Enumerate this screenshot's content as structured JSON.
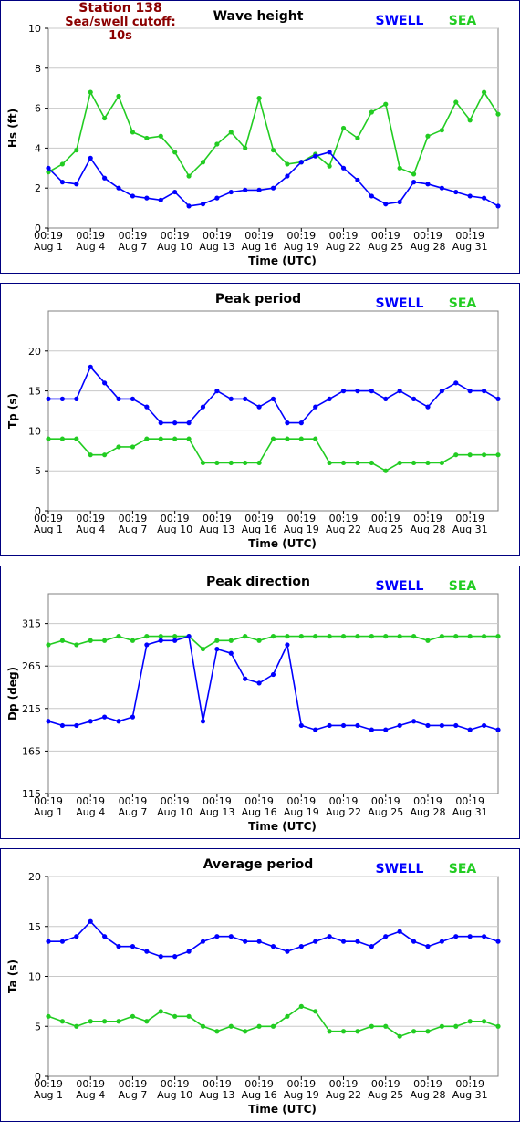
{
  "station": {
    "name": "Station 138",
    "cutoff": "Sea/swell cutoff: 10s"
  },
  "colors": {
    "swell": "#0000ff",
    "sea": "#22cc22",
    "border": "#000080",
    "grid": "#c8c8c8"
  },
  "legend": {
    "swell": "SWELL",
    "sea": "SEA"
  },
  "shared_x": {
    "xlabel": "Time (UTC)",
    "tick_time": [
      "00:19",
      "00:19",
      "00:19",
      "00:19",
      "00:19",
      "00:19",
      "00:19",
      "00:19",
      "00:19",
      "00:19",
      "00:19"
    ],
    "tick_date": [
      "Aug 1",
      "Aug 4",
      "Aug 7",
      "Aug 10",
      "Aug 13",
      "Aug 16",
      "Aug 19",
      "Aug 22",
      "Aug 25",
      "Aug 28",
      "Aug 31"
    ]
  },
  "chart_data": [
    {
      "type": "line",
      "title": "Wave height",
      "ylabel": "Hs (ft)",
      "ylim": [
        0,
        10
      ],
      "yticks": [
        0,
        2,
        4,
        6,
        8,
        10
      ],
      "x": [
        1,
        2,
        3,
        4,
        5,
        6,
        7,
        8,
        9,
        10,
        11,
        12,
        13,
        14,
        15,
        16,
        17,
        18,
        19,
        20,
        21,
        22,
        23,
        24,
        25,
        26,
        27,
        28,
        29,
        30,
        31,
        32,
        33
      ],
      "series": [
        {
          "name": "SWELL",
          "values": [
            3.0,
            2.3,
            2.2,
            3.5,
            2.5,
            2.0,
            1.6,
            1.5,
            1.4,
            1.8,
            1.1,
            1.2,
            1.5,
            1.8,
            1.9,
            1.9,
            2.0,
            2.6,
            3.3,
            3.6,
            3.8,
            3.0,
            2.4,
            1.6,
            1.2,
            1.3,
            2.3,
            2.2,
            2.0,
            1.8,
            1.6,
            1.5,
            1.1
          ]
        },
        {
          "name": "SEA",
          "values": [
            2.8,
            3.2,
            3.9,
            6.8,
            5.5,
            6.6,
            4.8,
            4.5,
            4.6,
            3.8,
            2.6,
            3.3,
            4.2,
            4.8,
            4.0,
            6.5,
            3.9,
            3.2,
            3.3,
            3.7,
            3.1,
            5.0,
            4.5,
            5.8,
            6.2,
            3.0,
            2.7,
            4.6,
            4.9,
            6.3,
            5.4,
            6.8,
            5.7
          ]
        }
      ]
    },
    {
      "type": "line",
      "title": "Peak period",
      "ylabel": "Tp (s)",
      "ylim": [
        0,
        25
      ],
      "yticks": [
        0,
        5,
        10,
        15,
        20
      ],
      "x": [
        1,
        2,
        3,
        4,
        5,
        6,
        7,
        8,
        9,
        10,
        11,
        12,
        13,
        14,
        15,
        16,
        17,
        18,
        19,
        20,
        21,
        22,
        23,
        24,
        25,
        26,
        27,
        28,
        29,
        30,
        31,
        32,
        33
      ],
      "series": [
        {
          "name": "SWELL",
          "values": [
            14,
            14,
            14,
            18,
            16,
            14,
            14,
            13,
            11,
            11,
            11,
            13,
            15,
            14,
            14,
            13,
            14,
            11,
            11,
            13,
            14,
            15,
            15,
            15,
            14,
            15,
            14,
            13,
            15,
            16,
            15,
            15,
            14
          ]
        },
        {
          "name": "SEA",
          "values": [
            9,
            9,
            9,
            7,
            7,
            8,
            8,
            9,
            9,
            9,
            9,
            6,
            6,
            6,
            6,
            6,
            9,
            9,
            9,
            9,
            6,
            6,
            6,
            6,
            5,
            6,
            6,
            6,
            6,
            7,
            7,
            7,
            7
          ]
        }
      ]
    },
    {
      "type": "line",
      "title": "Peak direction",
      "ylabel": "Dp (deg)",
      "ylim": [
        115,
        350
      ],
      "yticks": [
        115,
        165,
        215,
        265,
        315
      ],
      "x": [
        1,
        2,
        3,
        4,
        5,
        6,
        7,
        8,
        9,
        10,
        11,
        12,
        13,
        14,
        15,
        16,
        17,
        18,
        19,
        20,
        21,
        22,
        23,
        24,
        25,
        26,
        27,
        28,
        29,
        30,
        31,
        32,
        33
      ],
      "series": [
        {
          "name": "SWELL",
          "values": [
            200,
            195,
            195,
            200,
            205,
            200,
            205,
            290,
            295,
            295,
            300,
            200,
            285,
            280,
            250,
            245,
            255,
            290,
            195,
            190,
            195,
            195,
            195,
            190,
            190,
            195,
            200,
            195,
            195,
            195,
            190,
            195,
            190
          ]
        },
        {
          "name": "SEA",
          "values": [
            290,
            295,
            290,
            295,
            295,
            300,
            295,
            300,
            300,
            300,
            300,
            285,
            295,
            295,
            300,
            295,
            300,
            300,
            300,
            300,
            300,
            300,
            300,
            300,
            300,
            300,
            300,
            295,
            300,
            300,
            300,
            300,
            300
          ]
        }
      ]
    },
    {
      "type": "line",
      "title": "Average period",
      "ylabel": "Ta (s)",
      "ylim": [
        0,
        20
      ],
      "yticks": [
        0,
        5,
        10,
        15,
        20
      ],
      "x": [
        1,
        2,
        3,
        4,
        5,
        6,
        7,
        8,
        9,
        10,
        11,
        12,
        13,
        14,
        15,
        16,
        17,
        18,
        19,
        20,
        21,
        22,
        23,
        24,
        25,
        26,
        27,
        28,
        29,
        30,
        31,
        32,
        33
      ],
      "series": [
        {
          "name": "SWELL",
          "values": [
            13.5,
            13.5,
            14.0,
            15.5,
            14.0,
            13.0,
            13.0,
            12.5,
            12.0,
            12.0,
            12.5,
            13.5,
            14.0,
            14.0,
            13.5,
            13.5,
            13.0,
            12.5,
            13.0,
            13.5,
            14.0,
            13.5,
            13.5,
            13.0,
            14.0,
            14.5,
            13.5,
            13.0,
            13.5,
            14.0,
            14.0,
            14.0,
            13.5
          ]
        },
        {
          "name": "SEA",
          "values": [
            6.0,
            5.5,
            5.0,
            5.5,
            5.5,
            5.5,
            6.0,
            5.5,
            6.5,
            6.0,
            6.0,
            5.0,
            4.5,
            5.0,
            4.5,
            5.0,
            5.0,
            6.0,
            7.0,
            6.5,
            4.5,
            4.5,
            4.5,
            5.0,
            5.0,
            4.0,
            4.5,
            4.5,
            5.0,
            5.0,
            5.5,
            5.5,
            5.0
          ]
        }
      ]
    }
  ]
}
